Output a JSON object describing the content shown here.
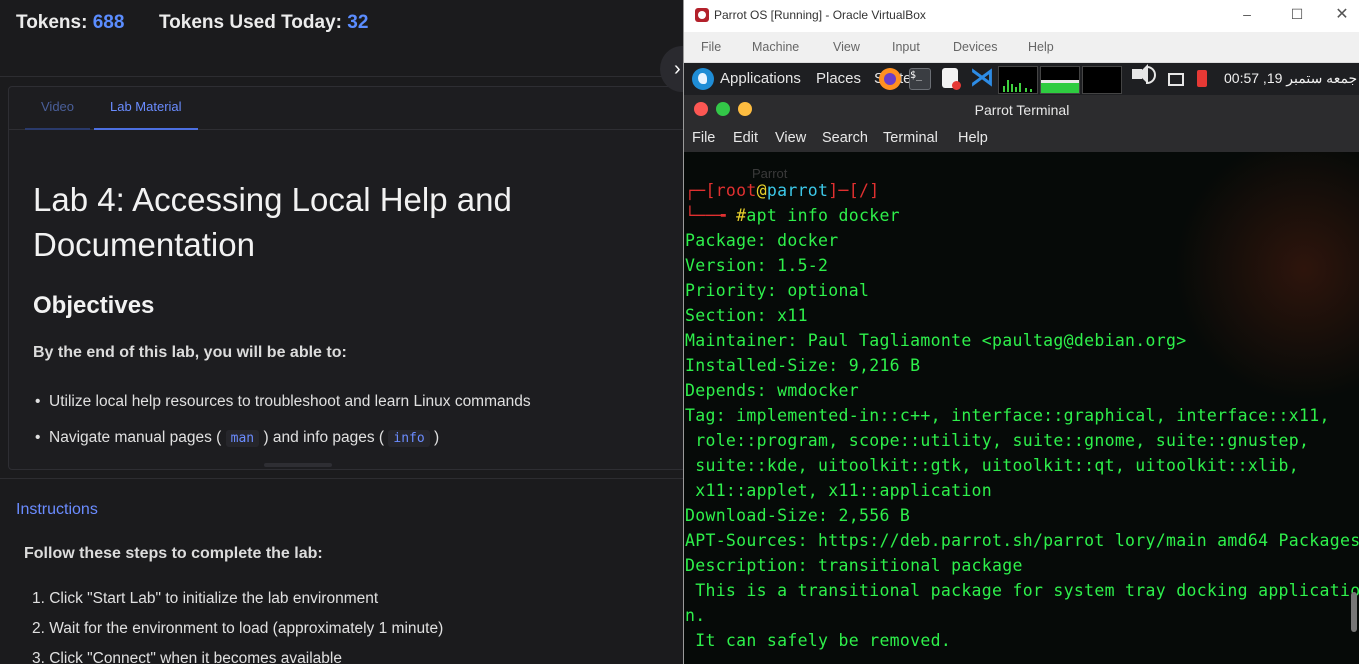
{
  "header": {
    "tokens_label": "Tokens:",
    "tokens_value": "688",
    "used_label": "Tokens Used Today:",
    "used_value": "32"
  },
  "tabs": [
    {
      "label": "Video"
    },
    {
      "label": "Lab Material"
    }
  ],
  "lab": {
    "title": "Lab 4: Accessing Local Help and Documentation",
    "objectives_heading": "Objectives",
    "intro": "By the end of this lab, you will be able to:",
    "bullet1": "Utilize local help resources to troubleshoot and learn Linux commands",
    "bullet2_pre": "Navigate manual pages (",
    "bullet2_code1": "man",
    "bullet2_mid": ") and info pages (",
    "bullet2_code2": "info",
    "bullet2_post": ")",
    "instructions_label": "Instructions",
    "steps_intro": "Follow these steps to complete the lab:",
    "steps": [
      "1. Click \"Start Lab\" to initialize the lab environment",
      "2. Wait for the environment to load (approximately 1 minute)",
      "3. Click \"Connect\" when it becomes available"
    ]
  },
  "vbox": {
    "title": "Parrot OS [Running] - Oracle VirtualBox",
    "menu": [
      "File",
      "Machine",
      "View",
      "Input",
      "Devices",
      "Help"
    ]
  },
  "guest_panel": {
    "applications": "Applications",
    "places": "Places",
    "system": "Syste",
    "terminal_icon_text": "$_",
    "clock": "جمعه ستمبر 19, 00:57"
  },
  "terminal": {
    "title": "Parrot Terminal",
    "menu": [
      "File",
      "Edit",
      "View",
      "Search",
      "Terminal",
      "Help"
    ],
    "bg_text": "Parrot",
    "prompt_user": "root",
    "prompt_at": "@",
    "prompt_host": "parrot",
    "prompt_dir": "/",
    "command": "apt info docker",
    "output": [
      "Package: docker",
      "Version: 1.5-2",
      "Priority: optional",
      "Section: x11",
      "Maintainer: Paul Tagliamonte <paultag@debian.org>",
      "Installed-Size: 9,216 B",
      "Depends: wmdocker",
      "Tag: implemented-in::c++, interface::graphical, interface::x11,",
      " role::program, scope::utility, suite::gnome, suite::gnustep,",
      " suite::kde, uitoolkit::gtk, uitoolkit::qt, uitoolkit::xlib,",
      " x11::applet, x11::application",
      "Download-Size: 2,556 B",
      "APT-Sources: https://deb.parrot.sh/parrot lory/main amd64 Packages",
      "Description: transitional package",
      " This is a transitional package for system tray docking applicatio",
      "n.",
      " It can safely be removed."
    ]
  },
  "colors": {
    "accent": "#5b8dff",
    "terminal_green": "#2ef04b",
    "prompt_red": "#e03030",
    "prompt_cyan": "#3cc8e8"
  }
}
